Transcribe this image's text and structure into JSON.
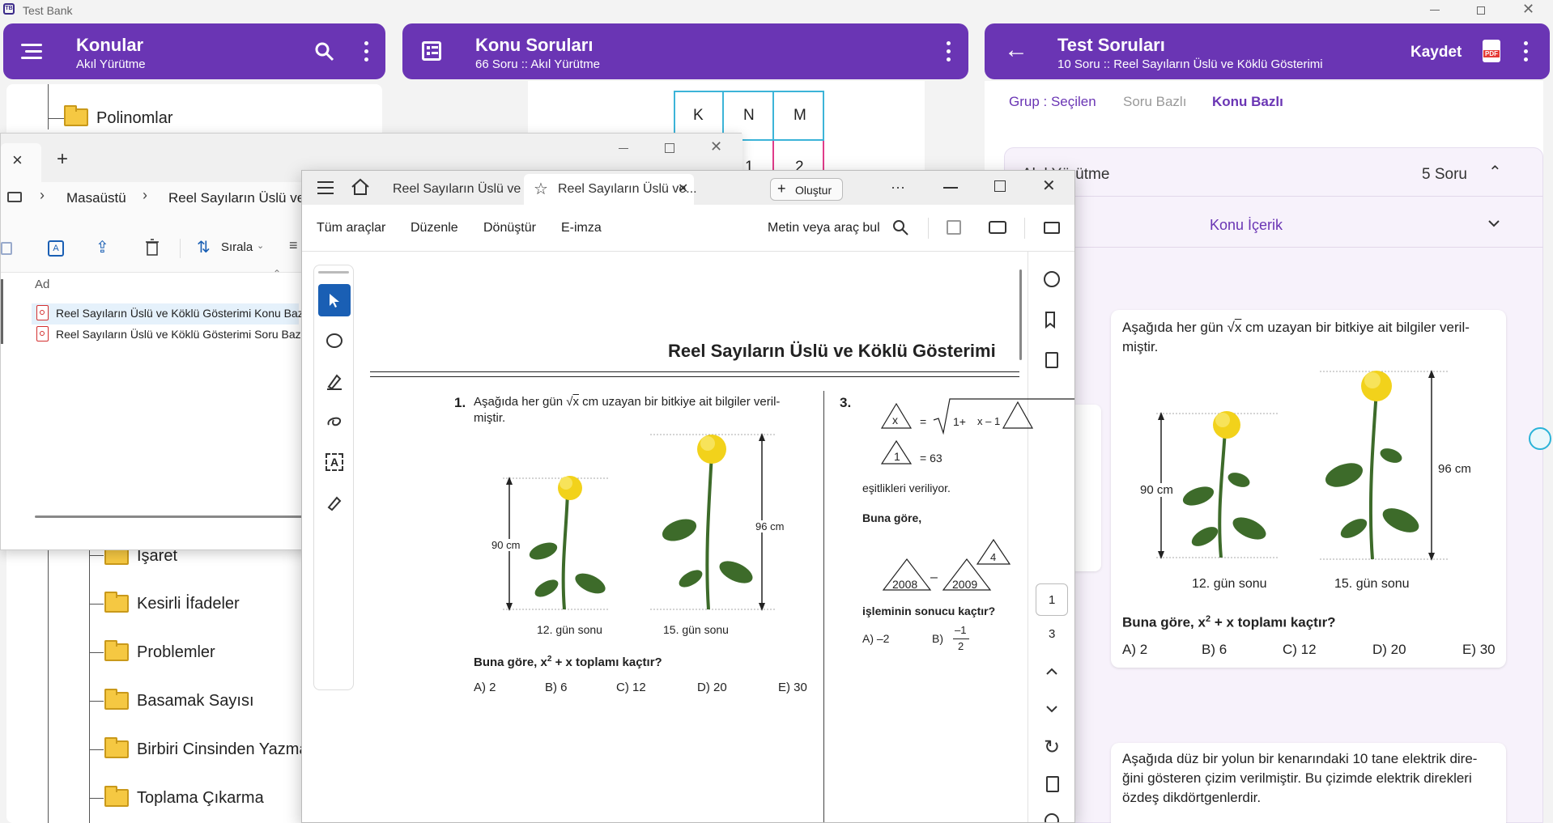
{
  "app": {
    "title": "Test Bank"
  },
  "panel1": {
    "title": "Konular",
    "subtitle": "Akıl Yürütme"
  },
  "panel2": {
    "title": "Konu Soruları",
    "subtitle": "66 Soru :: Akıl Yürütme",
    "table_headers": [
      "K",
      "N",
      "M"
    ],
    "table_row": [
      "1",
      "2"
    ]
  },
  "panel3": {
    "title": "Test Soruları",
    "subtitle": "10 Soru :: Reel Sayıların Üslü ve Köklü Gösterimi",
    "save_label": "Kaydet",
    "pdf_label": "PDF",
    "tabs": [
      "Grup : Seçilen",
      "Soru Bazlı",
      "Konu Bazlı"
    ],
    "group_title": "Akıl Yürütme",
    "group_count": "5 Soru",
    "subgroup": "Konu İçerik",
    "q1": {
      "text1": "Aşağıda her gün",
      "root": "x",
      "text2": "cm uzayan bir bitkiye ait bilgiler veril-",
      "text3": "miştir.",
      "h1": "90 cm",
      "h2": "96 cm",
      "cap1": "12. gün sonu",
      "cap2": "15. gün sonu",
      "ask_pre": "Buna göre, x",
      "ask_sup": "2",
      "ask_post": " + x toplamı kaçtır?",
      "opts": [
        "A) 2",
        "B) 6",
        "C) 12",
        "D) 20",
        "E) 30"
      ]
    },
    "q2": {
      "line1": "Aşağıda düz bir yolun bir kenarındaki 10 tane elektrik dire-",
      "line2": "ğini gösteren çizim verilmiştir. Bu çizimde elektrik direkleri",
      "line3": "özdeş dikdörtgenlerdir."
    }
  },
  "tree": {
    "top": "Polinomlar",
    "items": [
      "İşaret",
      "Kesirli İfadeler",
      "Problemler",
      "Basamak Sayısı",
      "Birbiri Cinsinden Yazma",
      "Toplama Çıkarma"
    ]
  },
  "explorer": {
    "tab_close": "×",
    "tab_add": "+",
    "crumbs": [
      "Masaüstü",
      "Reel Sayıların Üslü ve"
    ],
    "sort_label": "Sırala",
    "col_name": "Ad",
    "files": [
      "Reel Sayıların Üslü ve Köklü Gösterimi Konu Bazlı",
      "Reel Sayıların Üslü ve Köklü Gösterimi Soru Bazlı"
    ]
  },
  "reader": {
    "tabs": [
      "Reel Sayıların Üslü ve ...",
      "Reel Sayıların Üslü ve..."
    ],
    "new_label": "Oluştur",
    "more": "···",
    "menu": [
      "Tüm araçlar",
      "Düzenle",
      "Dönüştür",
      "E-imza"
    ],
    "search_label": "Metin veya araç bul",
    "page_current": "1",
    "page_total": "3",
    "doc": {
      "title": "Reel Sayıların Üslü ve Köklü Gösterimi",
      "q1": {
        "num": "1.",
        "line1": "Aşağıda her gün",
        "root": "x",
        "line1b": "cm uzayan bir bitkiye ait bilgiler veril-",
        "line2": "miştir.",
        "h1": "90 cm",
        "h2": "96 cm",
        "cap1": "12. gün sonu",
        "cap2": "15. gün sonu",
        "ask_pre": "Buna göre, x",
        "ask_sup": "2",
        "ask_post": " + x toplamı kaçtır?",
        "opts": [
          "A) 2",
          "B) 6",
          "C) 12",
          "D) 20",
          "E) 30"
        ]
      },
      "q3": {
        "num": "3.",
        "tri_x": "x",
        "eq": "=",
        "root_pre": "1+",
        "tri_x1": "x – 1",
        "tri_1": "1",
        "eq63": "= 63",
        "given": "eşitlikleri veriliyor.",
        "buna": "Buna göre,",
        "t2008": "2008",
        "minus": "–",
        "t2009": "2009",
        "t4": "4",
        "ask": "işleminin sonucu kaçtır?",
        "optA": "A) –2",
        "optB": "B)",
        "fracN": "–1",
        "fracD": "2"
      }
    }
  },
  "colors": {
    "purple": "#6a35b4",
    "accent_blue": "#1a5fb4",
    "rose": "#f2d21b",
    "stem": "#3d6b2a"
  }
}
